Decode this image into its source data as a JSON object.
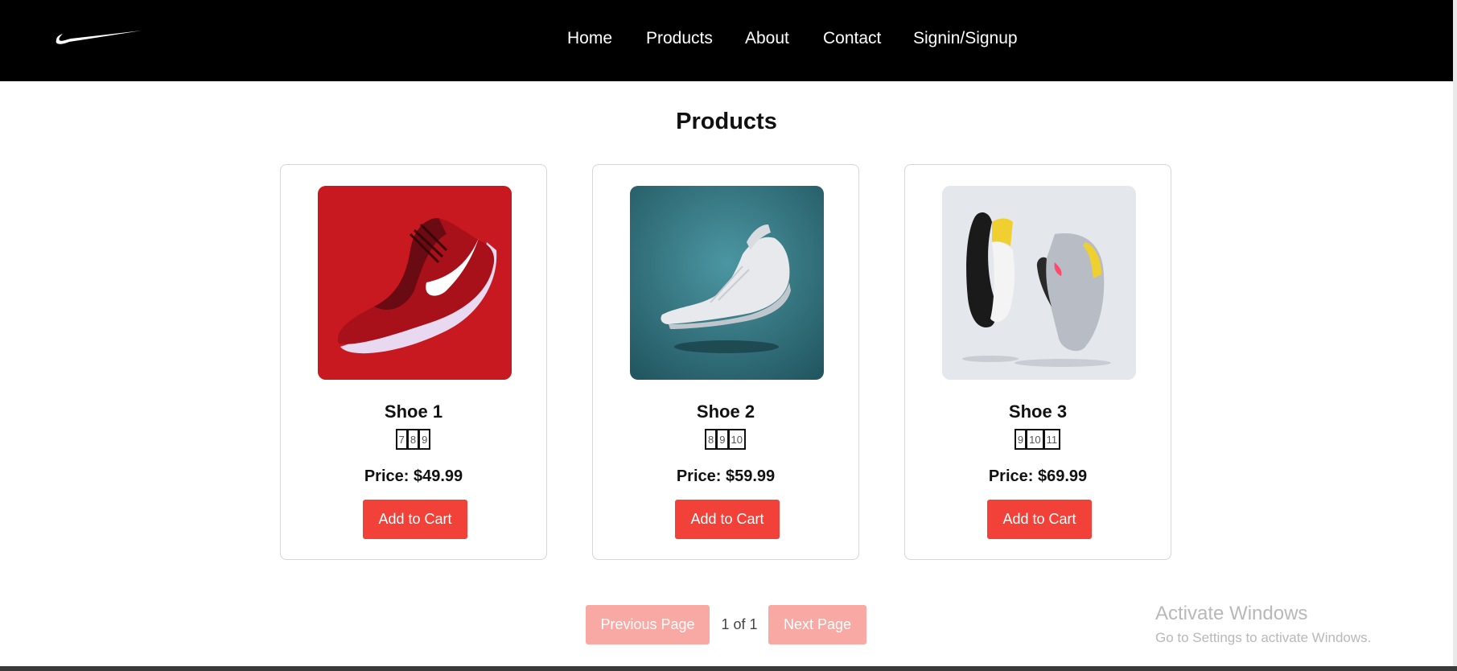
{
  "nav": {
    "links": [
      "Home",
      "Products",
      "About",
      "Contact",
      "Signin/Signup"
    ]
  },
  "main": {
    "title": "Products",
    "products": [
      {
        "name": "Shoe 1",
        "sizes": [
          "7",
          "8",
          "9"
        ],
        "price": "Price: $49.99",
        "button": "Add to Cart",
        "image_bg": "#d01c22"
      },
      {
        "name": "Shoe 2",
        "sizes": [
          "8",
          "9",
          "10"
        ],
        "price": "Price: $59.99",
        "button": "Add to Cart",
        "image_bg": "#2f6f7a"
      },
      {
        "name": "Shoe 3",
        "sizes": [
          "9",
          "10",
          "11"
        ],
        "price": "Price: $69.99",
        "button": "Add to Cart",
        "image_bg": "#e4e7ec"
      }
    ]
  },
  "pagination": {
    "prev_label": "Previous Page",
    "page_indicator": "1 of 1",
    "next_label": "Next Page"
  },
  "watermark": {
    "title": "Activate Windows",
    "subtitle": "Go to Settings to activate Windows."
  },
  "colors": {
    "nav_bg": "#000000",
    "accent": "#f24138",
    "accent_disabled": "#f8a9a4"
  }
}
